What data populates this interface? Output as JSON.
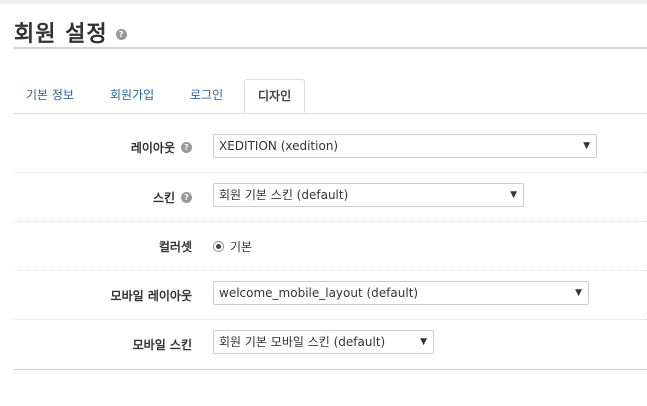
{
  "page": {
    "title": "회원 설정",
    "help_icon": "question-circle-icon"
  },
  "tabs": [
    {
      "label": "기본 정보",
      "active": false
    },
    {
      "label": "회원가입",
      "active": false
    },
    {
      "label": "로그인",
      "active": false
    },
    {
      "label": "디자인",
      "active": true
    }
  ],
  "form": {
    "layout": {
      "label": "레이아웃",
      "value": "XEDITION (xedition)"
    },
    "skin": {
      "label": "스킨",
      "value": "회원 기본 스킨 (default)"
    },
    "colorset": {
      "label": "컬러셋",
      "option": "기본",
      "checked": true
    },
    "mobile_layout": {
      "label": "모바일 레이아웃",
      "value": "welcome_mobile_layout (default)"
    },
    "mobile_skin": {
      "label": "모바일 스킨",
      "value": "회원 기본 모바일 스킨 (default)"
    }
  },
  "glyphs": {
    "help": "?",
    "dropdown": "▼"
  },
  "colors": {
    "link": "#2a6496",
    "help_bg": "#999999"
  }
}
